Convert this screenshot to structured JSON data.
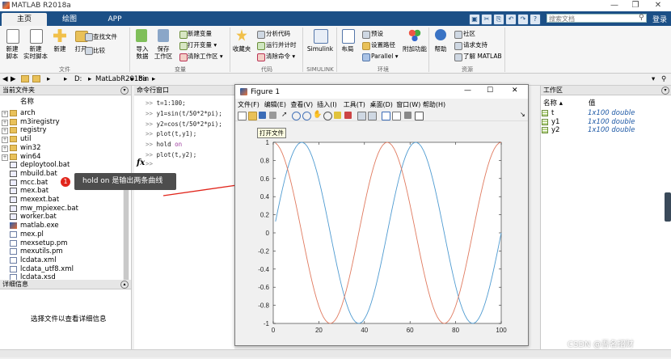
{
  "window": {
    "title": "MATLAB R2018a",
    "minimize": "—",
    "restore": "❐",
    "close": "✕"
  },
  "tabs": [
    {
      "label": "主页"
    },
    {
      "label": "绘图"
    },
    {
      "label": "APP"
    }
  ],
  "search": {
    "placeholder": "搜索文档",
    "signin": "登录"
  },
  "ribbon": {
    "file": {
      "new_script": "新建\n脚本",
      "new_live_script": "新建\n实时脚本",
      "new": "新建",
      "open": "打开",
      "find_files": "查找文件",
      "compare": "比较",
      "group": "文件"
    },
    "variable": {
      "import": "导入\n数据",
      "save_ws": "保存\n工作区",
      "new_var": "新建变量",
      "open_var": "打开变量 ▾",
      "clear_ws": "清除工作区 ▾",
      "group": "变量"
    },
    "code": {
      "favorites": "收藏夹",
      "analyze": "分析代码",
      "run_time": "运行并计时",
      "clear_cmd": "清除命令 ▾",
      "group": "代码"
    },
    "simulink": {
      "label": "Simulink",
      "group": "SIMULINK"
    },
    "env": {
      "layout": "布局",
      "prefs": "预设",
      "set_path": "设置路径",
      "parallel": "Parallel ▾",
      "addons": "附加功能",
      "group": "环境"
    },
    "resources": {
      "help": "帮助",
      "community": "社区",
      "support": "请求支持",
      "learn": "了解 MATLAB",
      "group": "资源"
    }
  },
  "address": {
    "segments": [
      "D:",
      "MatLabR2018a",
      "bin"
    ]
  },
  "folder_panel": {
    "title": "当前文件夹",
    "col_name": "名称",
    "items": [
      {
        "name": "arch",
        "type": "folder",
        "expandable": true
      },
      {
        "name": "m3iregistry",
        "type": "folder",
        "expandable": true
      },
      {
        "name": "registry",
        "type": "folder",
        "expandable": true
      },
      {
        "name": "util",
        "type": "folder",
        "expandable": true
      },
      {
        "name": "win32",
        "type": "folder",
        "expandable": true
      },
      {
        "name": "win64",
        "type": "folder",
        "expandable": true
      },
      {
        "name": "deploytool.bat",
        "type": "bat"
      },
      {
        "name": "mbuild.bat",
        "type": "bat"
      },
      {
        "name": "mcc.bat",
        "type": "bat"
      },
      {
        "name": "mex.bat",
        "type": "bat"
      },
      {
        "name": "mexext.bat",
        "type": "bat"
      },
      {
        "name": "mw_mpiexec.bat",
        "type": "bat"
      },
      {
        "name": "worker.bat",
        "type": "bat"
      },
      {
        "name": "matlab.exe",
        "type": "exe"
      },
      {
        "name": "mex.pl",
        "type": "file"
      },
      {
        "name": "mexsetup.pm",
        "type": "file"
      },
      {
        "name": "mexutils.pm",
        "type": "file"
      },
      {
        "name": "lcdata.xml",
        "type": "file"
      },
      {
        "name": "lcdata_utf8.xml",
        "type": "file"
      },
      {
        "name": "lcdata.xsd",
        "type": "file"
      }
    ]
  },
  "details_panel": {
    "title": "详细信息",
    "empty_text": "选择文件以查看详细信息"
  },
  "command_window": {
    "title": "命令行窗口",
    "lines": [
      {
        "prompt": ">>",
        "code": "t=1:100;"
      },
      {
        "prompt": ">>",
        "code": "y1=sin(t/50*2*pi);"
      },
      {
        "prompt": ">>",
        "code": "y2=cos(t/50*2*pi);"
      },
      {
        "prompt": ">>",
        "code": "plot(t,y1);"
      },
      {
        "prompt": ">>",
        "code": "hold ",
        "kw": "on"
      },
      {
        "prompt": ">>",
        "code": "plot(t,y2);"
      }
    ],
    "fx": "fx",
    "current_prompt": ">>"
  },
  "workspace": {
    "title": "工作区",
    "col_name": "名称 ▴",
    "col_value": "值",
    "vars": [
      {
        "name": "t",
        "value": "1x100 double"
      },
      {
        "name": "y1",
        "value": "1x100 double"
      },
      {
        "name": "y2",
        "value": "1x100 double"
      }
    ]
  },
  "figure": {
    "title": "Figure 1",
    "menu": [
      "文件(F)",
      "编辑(E)",
      "查看(V)",
      "插入(I)",
      "工具(T)",
      "桌面(D)",
      "窗口(W)",
      "帮助(H)"
    ],
    "tooltip": "打开文件",
    "min": "—",
    "max": "☐",
    "close": "✕"
  },
  "annotation": {
    "number": "1",
    "text": "hold on 是输出两条曲线"
  },
  "watermark": "CSDN @吾名招财",
  "colors": {
    "series1": "#4f9bd1",
    "series2": "#e07a5f",
    "tabstrip": "#1b4f86"
  },
  "chart_data": {
    "type": "line",
    "title": "",
    "xlabel": "",
    "ylabel": "",
    "xlim": [
      0,
      100
    ],
    "ylim": [
      -1,
      1
    ],
    "xticks": [
      "0",
      "20",
      "40",
      "60",
      "80",
      "100"
    ],
    "yticks": [
      "-1",
      "-0.8",
      "-0.6",
      "-0.4",
      "-0.2",
      "0",
      "0.2",
      "0.4",
      "0.6",
      "0.8",
      "1"
    ],
    "series": [
      {
        "formula": "sin(t/50*2*pi)",
        "x_range": [
          1,
          100
        ],
        "color": "#4f9bd1"
      },
      {
        "formula": "cos(t/50*2*pi)",
        "x_range": [
          1,
          100
        ],
        "color": "#e07a5f"
      }
    ],
    "grid": false,
    "legend": "none"
  }
}
